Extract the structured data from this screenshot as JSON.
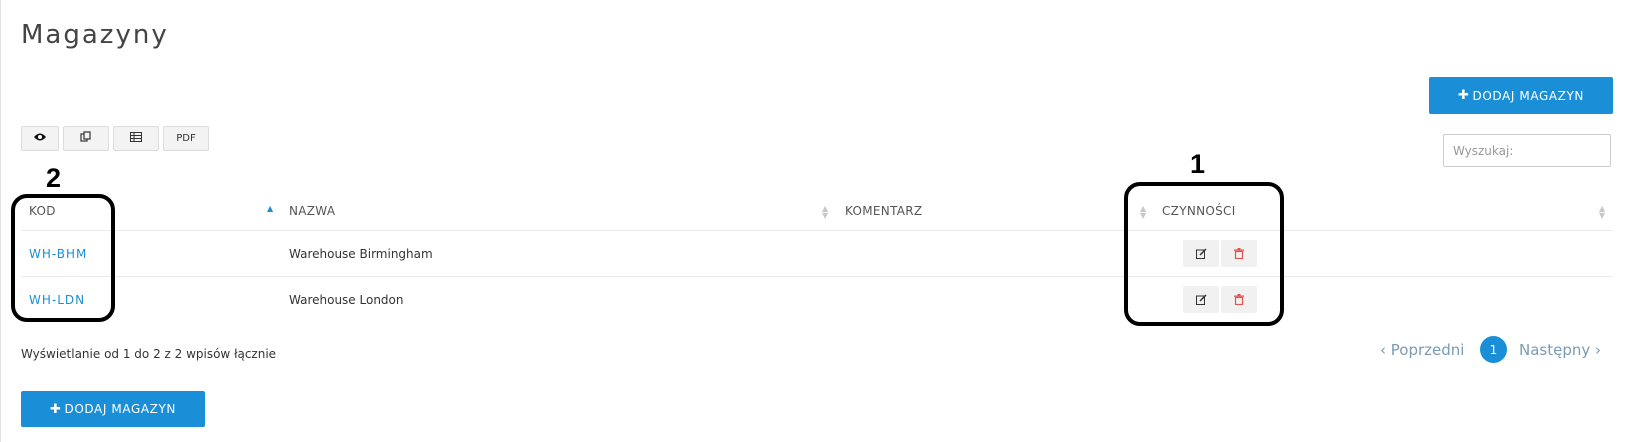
{
  "page": {
    "title": "Magazyny"
  },
  "actions": {
    "add_warehouse_label": "DODAJ MAGAZYN"
  },
  "toolbar": {
    "pdf_label": "PDF"
  },
  "search": {
    "placeholder": "Wyszukaj:"
  },
  "table": {
    "columns": [
      "KOD",
      "NAZWA",
      "KOMENTARZ",
      "CZYNNOŚCI"
    ],
    "rows": [
      {
        "code": "WH-BHM",
        "name": "Warehouse Birmingham",
        "comment": ""
      },
      {
        "code": "WH-LDN",
        "name": "Warehouse London",
        "comment": ""
      }
    ]
  },
  "footer": {
    "info": "Wyświetlanie od 1 do 2 z 2 wpisów łącznie",
    "prev": "Poprzedni",
    "page": "1",
    "next": "Następny"
  },
  "annotations": [
    "1",
    "2"
  ],
  "colors": {
    "accent": "#1a8fd8",
    "delete": "#e0534e"
  }
}
